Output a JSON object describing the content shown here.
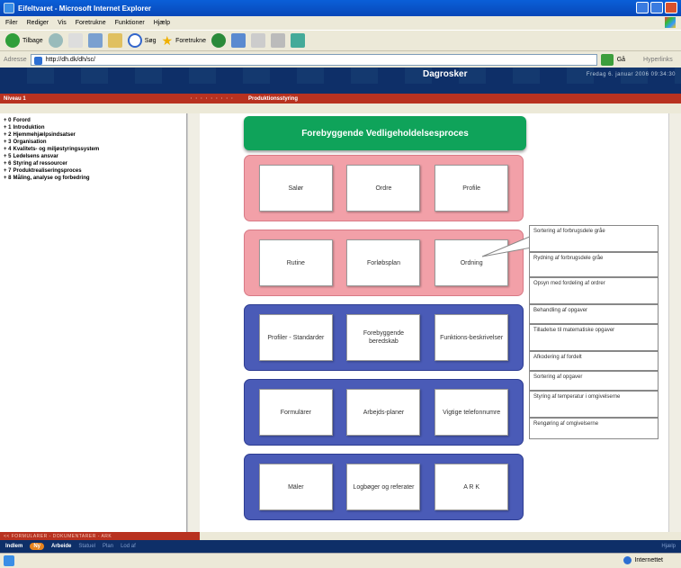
{
  "window": {
    "title": "Eifeltvaret - Microsoft Internet Explorer"
  },
  "menu": [
    "Filer",
    "Rediger",
    "Vis",
    "Foretrukne",
    "Funktioner",
    "Hjælp"
  ],
  "toolbar": {
    "back": "Tilbage",
    "search": "Søg",
    "favorites": "Foretrukne"
  },
  "address": {
    "label": "Adresse",
    "value": "http://dh.dk/dh/sc/",
    "go": "Gå",
    "links": "Hyperlinks"
  },
  "header": {
    "logo": "Dagrosker",
    "datetime": "Fredag 6. januar 2006     09:34:30",
    "user": "Niveau 1",
    "section": "Produktionsstyring"
  },
  "sidebar": {
    "items": [
      {
        "prefix": "+ 0",
        "label": "Forord"
      },
      {
        "prefix": "+ 1",
        "label": "Introduktion"
      },
      {
        "prefix": "+ 2",
        "label": "Hjemmehjælpsindsatser"
      },
      {
        "prefix": "+ 3",
        "label": "Organisation"
      },
      {
        "prefix": "+ 4",
        "label": "Kvalitets- og miljøstyringssystem"
      },
      {
        "prefix": "+ 5",
        "label": "Ledelsens ansvar"
      },
      {
        "prefix": "+ 6",
        "label": "Styring af ressourcer"
      },
      {
        "prefix": "+ 7",
        "label": "Produktrealiseringsproces"
      },
      {
        "prefix": "+ 8",
        "label": "Måling, analyse og forbedring"
      }
    ]
  },
  "diagram": {
    "header": "Forebyggende Vedligeholdelsesproces",
    "groups": [
      {
        "color": "red",
        "cards": [
          "Salør",
          "Ordre",
          "Profile"
        ]
      },
      {
        "color": "red",
        "cards": [
          "Rutine",
          "Forløbsplan",
          "Ordning"
        ]
      },
      {
        "color": "blue",
        "cards": [
          "Profiler - Standarder",
          "Forebyggende beredskab",
          "Funktions-beskrivelser"
        ]
      },
      {
        "color": "blue",
        "cards": [
          "Formulärer",
          "Arbejds-planer",
          "Vigtige telefonnumre"
        ]
      },
      {
        "color": "blue",
        "cards": [
          "Mäler",
          "Logbøger og referater",
          "A R K"
        ]
      }
    ],
    "callouts": [
      "Sortering af forbrugsdele gråe",
      "Rydning af forbrugsdele gråe",
      "Opsyn med fordeling af ordrer",
      "Behandling af opgaver",
      "Tilladelse til matematiske opgaver",
      "Afkodering af fordelt",
      "Sortering af opgaver",
      "Styring af temperatur i omgivelserne",
      "Rengøring af omgivelserne"
    ]
  },
  "bottom": {
    "red_label": "<< FORMULARER - DOKUMENTARER - ARK",
    "nav_left": "Indlem",
    "badge": "Ny",
    "nav_active": "Arbeide",
    "nav_dim1": "Statuel",
    "nav_dim2": "Plan",
    "nav_dim3": "Lod af",
    "right": "Hjælp"
  },
  "status": {
    "zone": "Internettet"
  }
}
